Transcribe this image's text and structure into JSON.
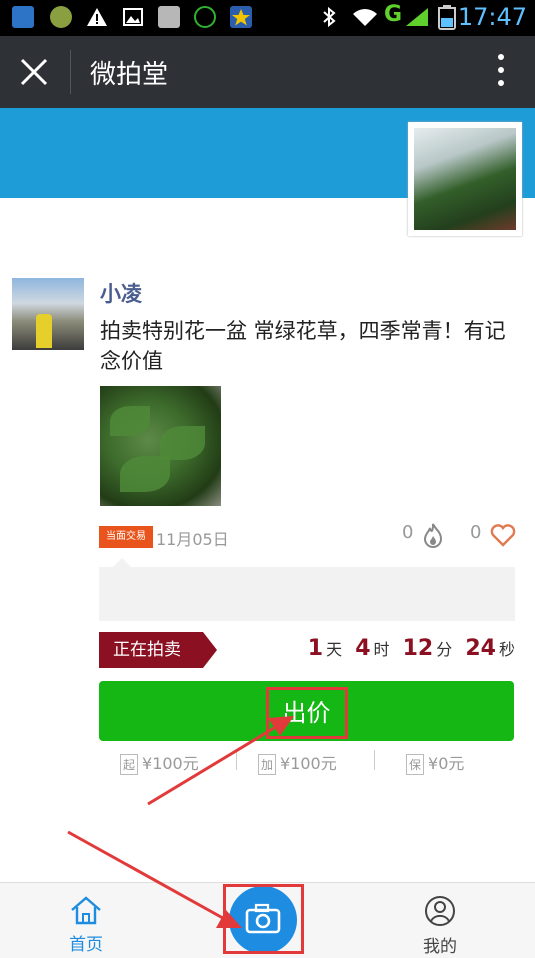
{
  "status_bar": {
    "time": "17:47",
    "notification_icons": [
      "news-icon",
      "app-icon",
      "warning-icon",
      "image-icon",
      "game-icon",
      "wechat-icon",
      "star-icon"
    ],
    "system_icons": [
      "bluetooth-icon",
      "wifi-icon",
      "signal-g-icon",
      "battery-icon"
    ]
  },
  "titlebar": {
    "title": "微拍堂"
  },
  "post": {
    "username": "小凌",
    "text": "拍卖特别花一盆  常绿花草，四季常青！有记念价值",
    "trade_tag": "当面交易",
    "date": "11月05日",
    "hot_count": "0",
    "like_count": "0"
  },
  "auction": {
    "status_label": "正在拍卖",
    "countdown": {
      "days": "1",
      "days_unit": "天",
      "hours": "4",
      "hours_unit": "时",
      "minutes": "12",
      "minutes_unit": "分",
      "seconds": "24",
      "seconds_unit": "秒"
    },
    "bid_button": "出价",
    "start_tag": "起",
    "start_price": "¥100元",
    "increment_tag": "加",
    "increment_price": "¥100元",
    "deposit_tag": "保",
    "deposit_price": "¥0元"
  },
  "tabbar": {
    "home_label": "首页",
    "me_label": "我的"
  },
  "colors": {
    "banner": "#1e9cd8",
    "accent_blue": "#1e8ce0",
    "bid_green": "#14b714",
    "auction_red": "#8a1022",
    "annotation_red": "#e23a3a"
  }
}
